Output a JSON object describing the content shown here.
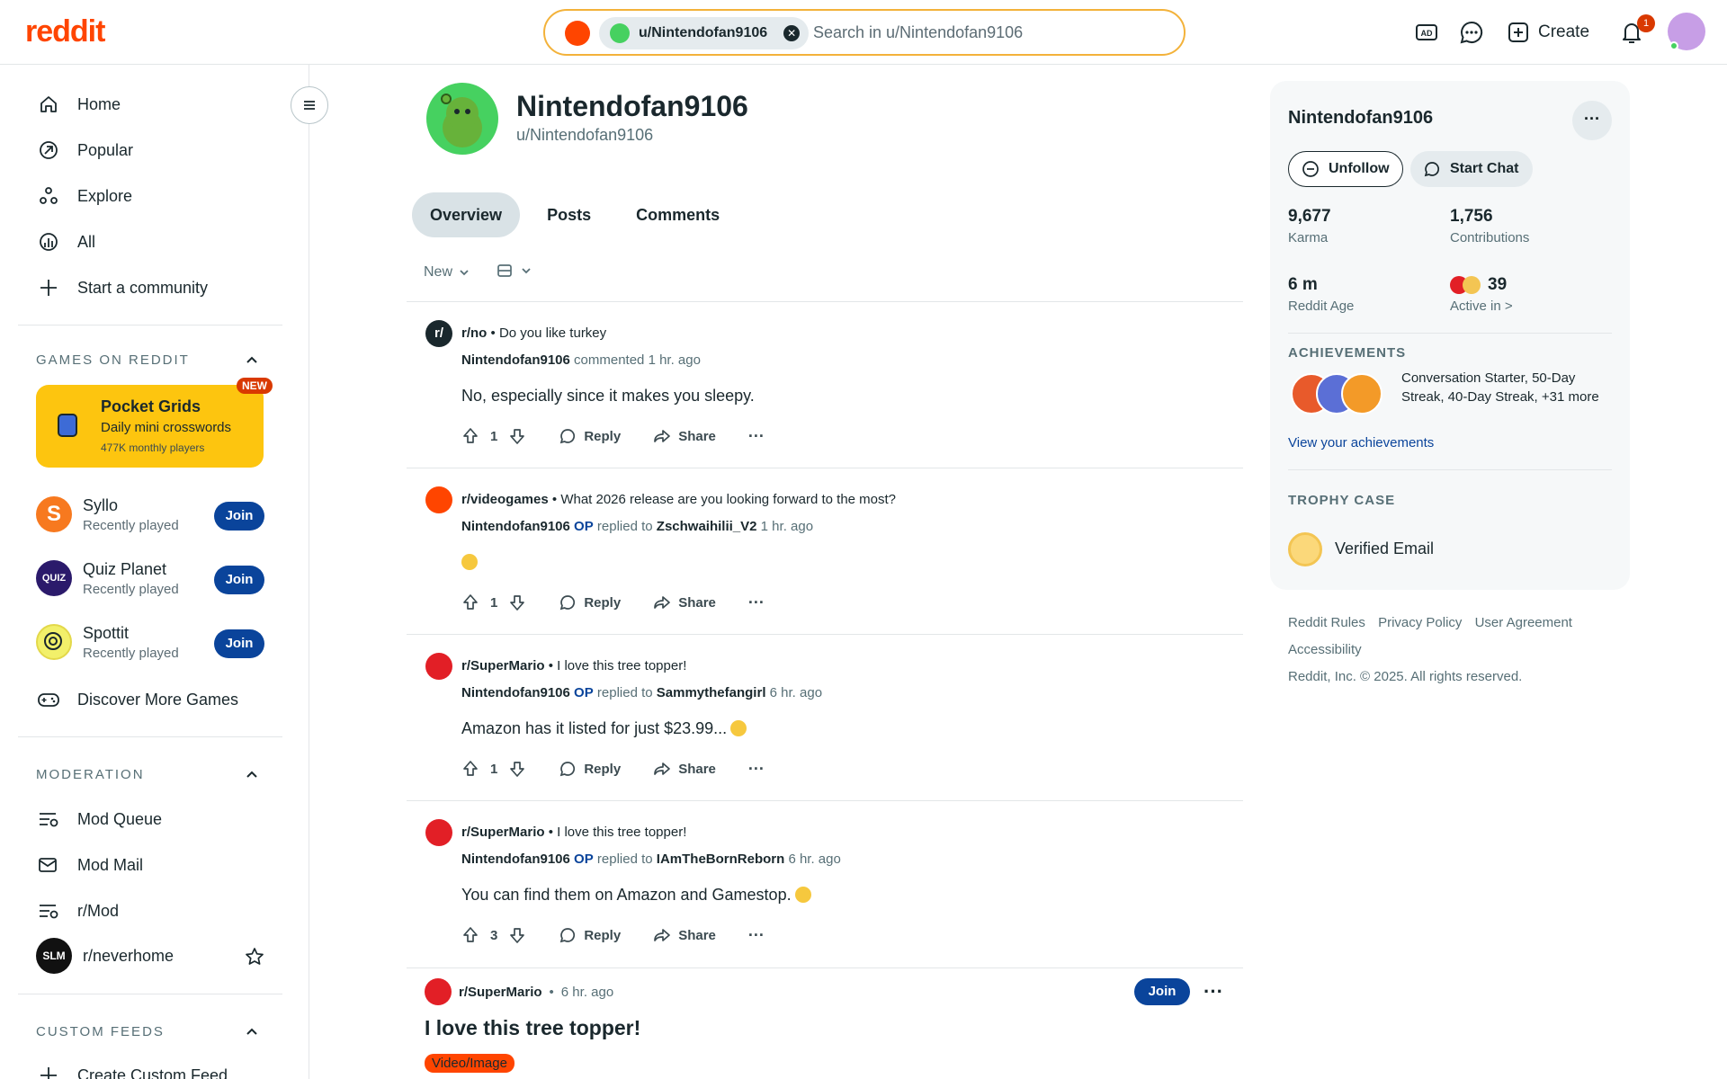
{
  "brand": {
    "logo": "reddit",
    "accent": "#ff4500",
    "join_color": "#0a449b"
  },
  "header": {
    "search": {
      "chip_label": "u/Nintendofan9106",
      "placeholder": "Search in u/Nintendofan9106"
    },
    "create_label": "Create",
    "notification_count": "1",
    "icons": [
      "ads-icon",
      "chat-icon",
      "create-icon",
      "bell-icon"
    ]
  },
  "sidebar": {
    "nav": [
      {
        "label": "Home",
        "icon": "home-icon"
      },
      {
        "label": "Popular",
        "icon": "popular-icon"
      },
      {
        "label": "Explore",
        "icon": "explore-icon"
      },
      {
        "label": "All",
        "icon": "all-icon"
      },
      {
        "label": "Start a community",
        "icon": "plus-icon"
      }
    ],
    "games": {
      "title": "GAMES ON REDDIT",
      "featured": {
        "title": "Pocket Grids",
        "subtitle": "Daily mini crosswords",
        "players": "477K monthly players",
        "badge": "NEW"
      },
      "items": [
        {
          "name": "Syllo",
          "sub": "Recently played",
          "join": "Join"
        },
        {
          "name": "Quiz Planet",
          "sub": "Recently played",
          "join": "Join"
        },
        {
          "name": "Spottit",
          "sub": "Recently played",
          "join": "Join"
        }
      ],
      "discover": "Discover More Games",
      "quiz_badge": "QUIZ",
      "syllo_letter": "S"
    },
    "moderation": {
      "title": "MODERATION",
      "items": [
        "Mod Queue",
        "Mod Mail",
        "r/Mod",
        "r/neverhome"
      ],
      "neverhome_avatar_text": "SLM"
    },
    "custom_feeds": {
      "title": "CUSTOM FEEDS",
      "create": "Create Custom Feed"
    }
  },
  "profile": {
    "display_name": "Nintendofan9106",
    "handle": "u/Nintendofan9106",
    "tabs": [
      "Overview",
      "Posts",
      "Comments"
    ],
    "sort": "New"
  },
  "feed": [
    {
      "sub": "r/no",
      "post_title": "Do you like turkey",
      "user": "Nintendofan9106",
      "op": "",
      "relation": "commented",
      "target": "",
      "time": "1 hr. ago",
      "body": "No, especially since it makes you sleepy.",
      "emoji": false,
      "votes": "1",
      "reply": "Reply",
      "share": "Share"
    },
    {
      "sub": "r/videogames",
      "post_title": "What 2026 release are you looking forward to the most?",
      "user": "Nintendofan9106",
      "op": "OP",
      "relation": "replied to",
      "target": "Zschwaihilii_V2",
      "time": "1 hr. ago",
      "body": "",
      "emoji": true,
      "votes": "1",
      "reply": "Reply",
      "share": "Share"
    },
    {
      "sub": "r/SuperMario",
      "post_title": "I love this tree topper!",
      "user": "Nintendofan9106",
      "op": "OP",
      "relation": "replied to",
      "target": "Sammythefangirl",
      "time": "6 hr. ago",
      "body": "Amazon has it listed for just $23.99...",
      "emoji": true,
      "votes": "1",
      "reply": "Reply",
      "share": "Share"
    },
    {
      "sub": "r/SuperMario",
      "post_title": "I love this tree topper!",
      "user": "Nintendofan9106",
      "op": "OP",
      "relation": "replied to",
      "target": "IAmTheBornReborn",
      "time": "6 hr. ago",
      "body": "You can find them on Amazon and Gamestop.",
      "emoji": true,
      "votes": "3",
      "reply": "Reply",
      "share": "Share"
    }
  ],
  "post": {
    "sub": "r/SuperMario",
    "time": "6 hr. ago",
    "title": "I love this tree topper!",
    "flair": "Video/Image",
    "join": "Join"
  },
  "card": {
    "name": "Nintendofan9106",
    "unfollow": "Unfollow",
    "chat": "Start Chat",
    "stats": [
      {
        "value": "9,677",
        "label": "Karma"
      },
      {
        "value": "1,756",
        "label": "Contributions"
      },
      {
        "value": "6 m",
        "label": "Reddit Age"
      },
      {
        "value": "39",
        "label": "Active in >"
      }
    ],
    "achievements_title": "ACHIEVEMENTS",
    "achievements_text": "Conversation Starter, 50-Day Streak, 40-Day Streak, +31 more",
    "achievements_link": "View your achievements",
    "trophy_title": "TROPHY CASE",
    "trophy": "Verified Email"
  },
  "footer": {
    "links": [
      "Reddit Rules",
      "Privacy Policy",
      "User Agreement",
      "Accessibility"
    ],
    "copyright": "Reddit, Inc. © 2025. All rights reserved."
  }
}
